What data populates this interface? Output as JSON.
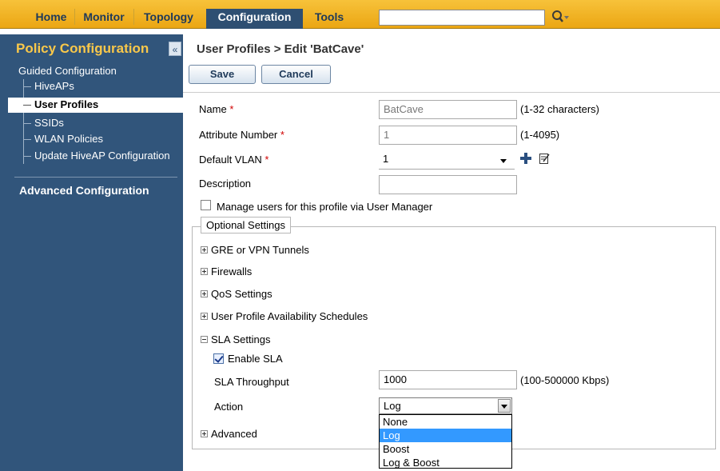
{
  "nav": {
    "tabs": [
      {
        "label": "Home"
      },
      {
        "label": "Monitor"
      },
      {
        "label": "Topology"
      },
      {
        "label": "Configuration"
      },
      {
        "label": "Tools"
      }
    ],
    "search_value": ""
  },
  "sidebar": {
    "title": "Policy Configuration",
    "collapse_glyph": "«",
    "guided": "Guided Configuration",
    "items": [
      {
        "label": "HiveAPs"
      },
      {
        "label": "User Profiles"
      },
      {
        "label": "SSIDs"
      },
      {
        "label": "WLAN Policies"
      },
      {
        "label": "Update HiveAP Configuration"
      }
    ],
    "advanced": "Advanced Configuration"
  },
  "main": {
    "breadcrumb": "User Profiles > Edit 'BatCave'",
    "save_label": "Save",
    "cancel_label": "Cancel",
    "fields": {
      "name": {
        "label": "Name",
        "required": "*",
        "value": "BatCave",
        "hint": "(1-32 characters)"
      },
      "attribute": {
        "label": "Attribute Number",
        "required": "*",
        "value": "1",
        "hint": "(1-4095)"
      },
      "vlan": {
        "label": "Default VLAN",
        "required": "*",
        "value": "1"
      },
      "description": {
        "label": "Description",
        "value": ""
      }
    },
    "manage_users_label": "Manage users for this profile via User Manager",
    "manage_users_checked": false,
    "optional_legend": "Optional Settings",
    "sections": {
      "gre": "GRE or VPN Tunnels",
      "firewalls": "Firewalls",
      "qos": "QoS Settings",
      "schedules": "User Profile Availability Schedules",
      "sla": "SLA Settings",
      "advanced": "Advanced"
    },
    "sla": {
      "enable_label": "Enable SLA",
      "enable_checked": true,
      "throughput_label": "SLA Throughput",
      "throughput_value": "1000",
      "throughput_hint": "(100-500000 Kbps)",
      "action_label": "Action",
      "action_value": "Log",
      "action_options": [
        "None",
        "Log",
        "Boost",
        "Log & Boost"
      ],
      "action_selected_index": 1
    }
  },
  "colors": {
    "nav_bg": "#eba613",
    "nav_active": "#2e4f72",
    "sidebar_bg": "#31557b",
    "sidebar_title": "#f9c84a",
    "required": "#d00000",
    "selected_option": "#3399ff"
  },
  "icons": {
    "search": "magnifier-icon",
    "collapse": "double-chevron-left-icon",
    "add_vlan": "plus-icon",
    "edit_vlan": "edit-icon"
  }
}
